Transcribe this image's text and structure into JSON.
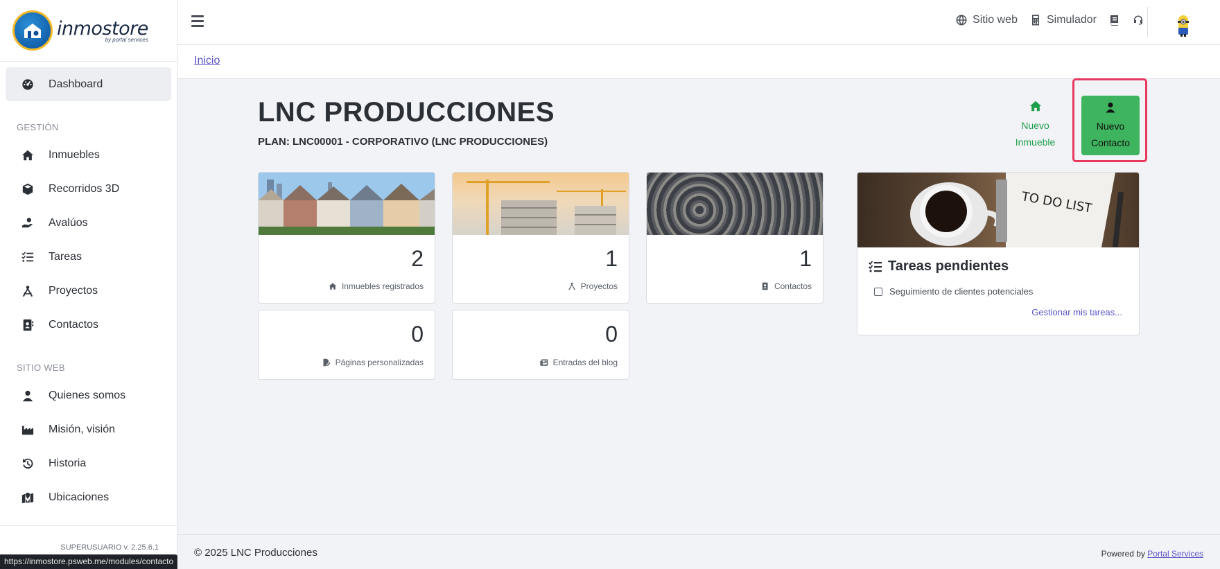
{
  "app": {
    "logo_text": "inmostore",
    "logo_sub": "by portal services"
  },
  "sidebar": {
    "dashboard_label": "Dashboard",
    "section_gestion": "GESTIÓN",
    "gestion_items": [
      {
        "label": "Inmuebles",
        "icon": "home-icon"
      },
      {
        "label": "Recorridos 3D",
        "icon": "cube-icon"
      },
      {
        "label": "Avalúos",
        "icon": "hand-coin-icon"
      },
      {
        "label": "Tareas",
        "icon": "task-list-icon"
      },
      {
        "label": "Proyectos",
        "icon": "compass-icon"
      },
      {
        "label": "Contactos",
        "icon": "address-book-icon"
      }
    ],
    "section_sitio": "SITIO WEB",
    "sitio_items": [
      {
        "label": "Quienes somos",
        "icon": "user-icon"
      },
      {
        "label": "Misión, visión",
        "icon": "industry-icon"
      },
      {
        "label": "Historia",
        "icon": "history-icon"
      },
      {
        "label": "Ubicaciones",
        "icon": "map-location-icon"
      }
    ],
    "version": "SUPERUSUARIO v. 2.25.6.1"
  },
  "status_url": "https://inmostore.psweb.me/modules/contacto",
  "topbar": {
    "sitio_web": "Sitio web",
    "simulador": "Simulador"
  },
  "breadcrumb": {
    "inicio": "Inicio"
  },
  "main": {
    "title": "LNC PRODUCCIONES",
    "plan": "PLAN: LNC00001 - CORPORATIVO (LNC PRODUCCIONES)",
    "quick_inmueble_line1": "Nuevo",
    "quick_inmueble_line2": "Inmueble",
    "quick_contacto_line1": "Nuevo",
    "quick_contacto_line2": "Contacto",
    "stats": [
      {
        "value": "2",
        "label": "Inmuebles registrados"
      },
      {
        "value": "1",
        "label": "Proyectos"
      },
      {
        "value": "1",
        "label": "Contactos"
      },
      {
        "value": "0",
        "label": "Páginas personalizadas"
      },
      {
        "value": "0",
        "label": "Entradas del blog"
      }
    ],
    "todo": {
      "title": "Tareas pendientes",
      "item": "Seguimiento de clientes potenciales",
      "link": "Gestionar mis tareas...",
      "image_text": "TO DO LIST"
    }
  },
  "footer": {
    "copyright": "© 2025 LNC Producciones",
    "powered_prefix": "Powered by",
    "powered_link": "Portal Services"
  },
  "colors": {
    "accent": "#5a55c9",
    "green": "#1e9e4a",
    "green_button": "#3fb45e",
    "highlight": "#e8385e"
  }
}
